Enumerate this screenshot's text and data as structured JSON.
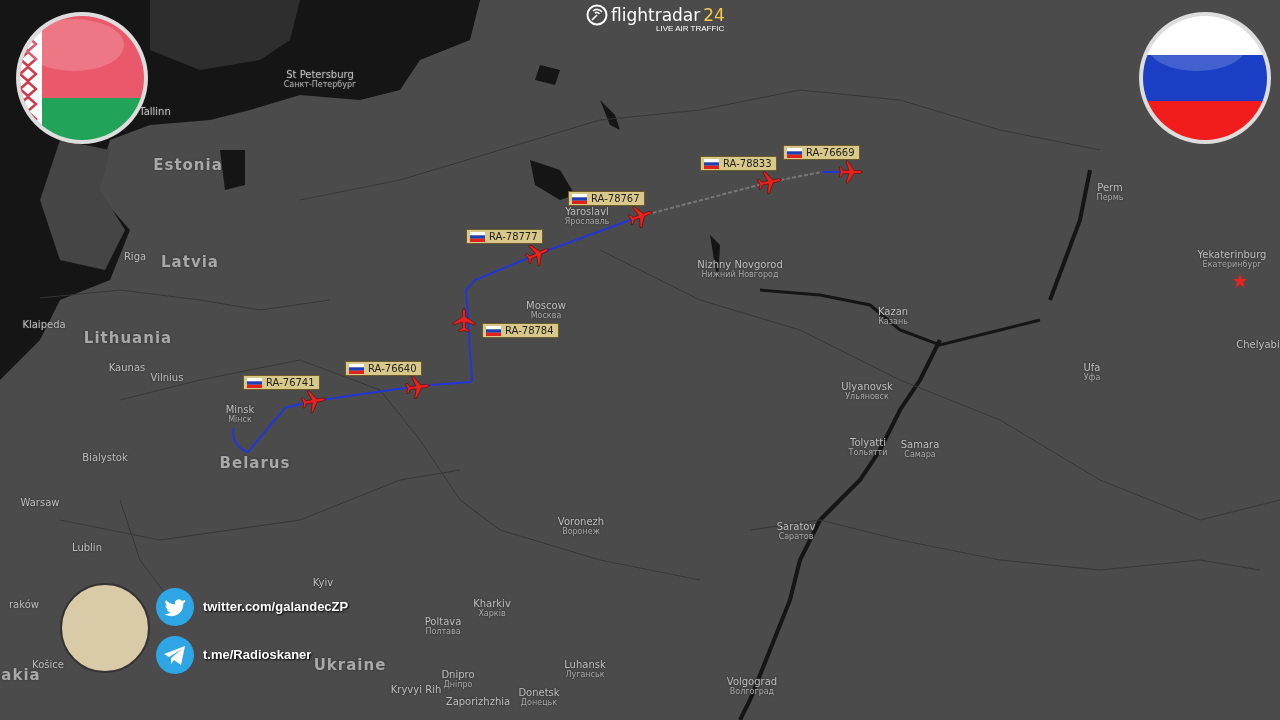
{
  "logo": {
    "name": "flightradar",
    "number": "24",
    "tagline": "LIVE AIR TRAFFIC"
  },
  "map": {
    "labels": [
      {
        "kind": "city",
        "text": "St Petersburg",
        "native": "Санкт-Петербург"
      },
      {
        "kind": "city",
        "text": "Tallinn"
      },
      {
        "kind": "country",
        "text": "Estonia"
      },
      {
        "kind": "city",
        "text": "Perm",
        "native": "Пермь"
      },
      {
        "kind": "city",
        "text": "Yaroslavl",
        "native": "Ярославль"
      },
      {
        "kind": "city",
        "text": "Riga"
      },
      {
        "kind": "country",
        "text": "Latvia"
      },
      {
        "kind": "city",
        "text": "Nizhny Novgorod",
        "native": "Нижний Новгород"
      },
      {
        "kind": "city",
        "text": "Yekaterinburg",
        "native": "Екатеринбург"
      },
      {
        "kind": "city",
        "text": "Moscow",
        "native": "Москва"
      },
      {
        "kind": "city",
        "text": "Kazan",
        "native": "Казань"
      },
      {
        "kind": "city",
        "text": "Klaipeda"
      },
      {
        "kind": "country",
        "text": "Lithuania"
      },
      {
        "kind": "city",
        "text": "Chelyabi"
      },
      {
        "kind": "city",
        "text": "Kaunas"
      },
      {
        "kind": "city",
        "text": "Vilnius"
      },
      {
        "kind": "city",
        "text": "Ufa",
        "native": "Уфа"
      },
      {
        "kind": "city",
        "text": "Ulyanovsk",
        "native": "Ульяновск"
      },
      {
        "kind": "city",
        "text": "Minsk",
        "native": "Мінск"
      },
      {
        "kind": "city",
        "text": "Tolyatti",
        "native": "Тольятти"
      },
      {
        "kind": "city",
        "text": "Samara",
        "native": "Самара"
      },
      {
        "kind": "city",
        "text": "Bialystok"
      },
      {
        "kind": "country",
        "text": "Belarus"
      },
      {
        "kind": "city",
        "text": "Warsaw"
      },
      {
        "kind": "city",
        "text": "Voronezh",
        "native": "Воронеж"
      },
      {
        "kind": "city",
        "text": "Saratov",
        "native": "Саратов"
      },
      {
        "kind": "city",
        "text": "Lublin"
      },
      {
        "kind": "city",
        "text": "Kyiv"
      },
      {
        "kind": "city",
        "text": "raków"
      },
      {
        "kind": "city",
        "text": "Kharkiv",
        "native": "Харків"
      },
      {
        "kind": "city",
        "text": "Poltava",
        "native": "Полтава"
      },
      {
        "kind": "country",
        "text": "akia"
      },
      {
        "kind": "city",
        "text": "Košice"
      },
      {
        "kind": "country",
        "text": "Ukraine"
      },
      {
        "kind": "city",
        "text": "Dnipro",
        "native": "Дніпро"
      },
      {
        "kind": "city",
        "text": "Luhansk",
        "native": "Луганськ"
      },
      {
        "kind": "city",
        "text": "Kryvyi Rih"
      },
      {
        "kind": "city",
        "text": "Zaporizhzhia"
      },
      {
        "kind": "city",
        "text": "Donetsk",
        "native": "Донецьк"
      },
      {
        "kind": "city",
        "text": "Volgograd",
        "native": "Волгоград"
      }
    ]
  },
  "aircraft": [
    {
      "registration": "RA-76741"
    },
    {
      "registration": "RA-76640"
    },
    {
      "registration": "RA-78784"
    },
    {
      "registration": "RA-78777"
    },
    {
      "registration": "RA-78767"
    },
    {
      "registration": "RA-78833"
    },
    {
      "registration": "RA-76669"
    }
  ],
  "social": [
    {
      "kind": "twitter",
      "handle": "twitter.com/galandecZP"
    },
    {
      "kind": "telegram",
      "handle": "t.me/Radioskaner"
    }
  ]
}
